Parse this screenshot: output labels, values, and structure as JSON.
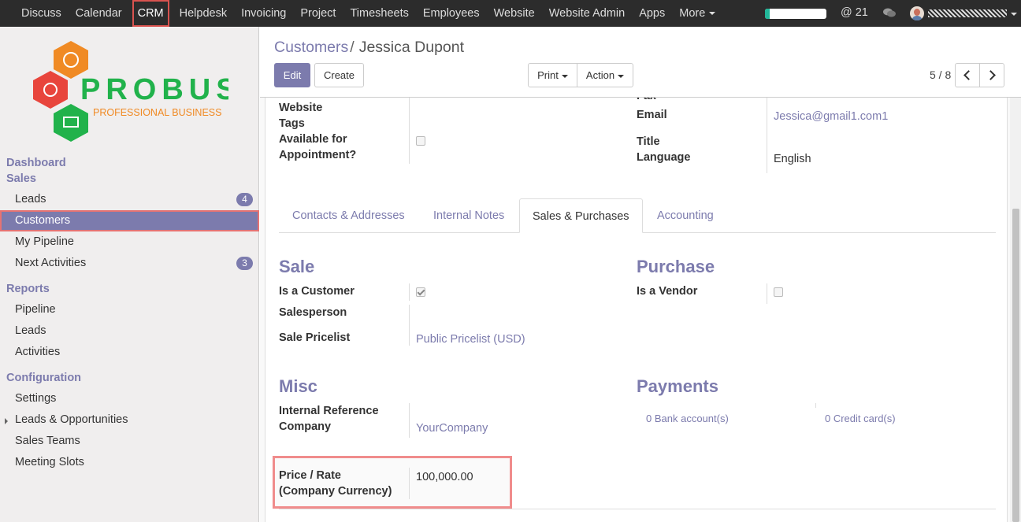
{
  "topbar": {
    "menu": [
      "Discuss",
      "Calendar",
      "CRM",
      "Helpdesk",
      "Invoicing",
      "Project",
      "Timesheets",
      "Employees",
      "Website",
      "Website Admin",
      "Apps",
      "More"
    ],
    "active": "CRM",
    "mentions": "@ 21",
    "progress_fraction": 0.08
  },
  "logo": {
    "name": "PROBUSE",
    "tagline": "PROFESSIONAL BUSINESS"
  },
  "sidebar": {
    "dashboard": "Dashboard",
    "sales": "Sales",
    "sales_items": [
      {
        "label": "Leads",
        "badge": "4"
      },
      {
        "label": "Customers"
      },
      {
        "label": "My Pipeline"
      },
      {
        "label": "Next Activities",
        "badge": "3"
      }
    ],
    "reports": "Reports",
    "report_items": [
      "Pipeline",
      "Leads",
      "Activities"
    ],
    "configuration": "Configuration",
    "config_items": [
      "Settings",
      "Leads & Opportunities",
      "Sales Teams",
      "Meeting Slots"
    ]
  },
  "breadcrumb": {
    "parent": "Customers",
    "sep": "/",
    "current": "Jessica Dupont"
  },
  "buttons": {
    "edit": "Edit",
    "create": "Create",
    "print": "Print",
    "action": "Action"
  },
  "pager": "5 / 8",
  "form": {
    "top_left": {
      "website": "Website",
      "tags": "Tags",
      "available_line1": "Available for",
      "available_line2": "Appointment?",
      "available_checked": false
    },
    "top_right": {
      "fax": "Fax",
      "email_label": "Email",
      "email": "Jessica@gmail1.com1",
      "title": "Title",
      "language_label": "Language",
      "language": "English"
    },
    "tabs": [
      "Contacts & Addresses",
      "Internal Notes",
      "Sales & Purchases",
      "Accounting"
    ],
    "active_tab": "Sales & Purchases",
    "sale": {
      "heading": "Sale",
      "is_customer": "Is a Customer",
      "is_customer_checked": true,
      "salesperson": "Salesperson",
      "pricelist_label": "Sale Pricelist",
      "pricelist": "Public Pricelist (USD)"
    },
    "purchase": {
      "heading": "Purchase",
      "is_vendor": "Is a Vendor",
      "is_vendor_checked": false
    },
    "misc": {
      "heading": "Misc",
      "internal_ref": "Internal Reference",
      "company_label": "Company",
      "company": "YourCompany"
    },
    "payments": {
      "heading": "Payments",
      "bank": "0 Bank account(s)",
      "card": "0 Credit card(s)"
    },
    "rate": {
      "label_line1": "Price / Rate",
      "label_line2": "(Company Currency)",
      "value": "100,000.00"
    }
  }
}
